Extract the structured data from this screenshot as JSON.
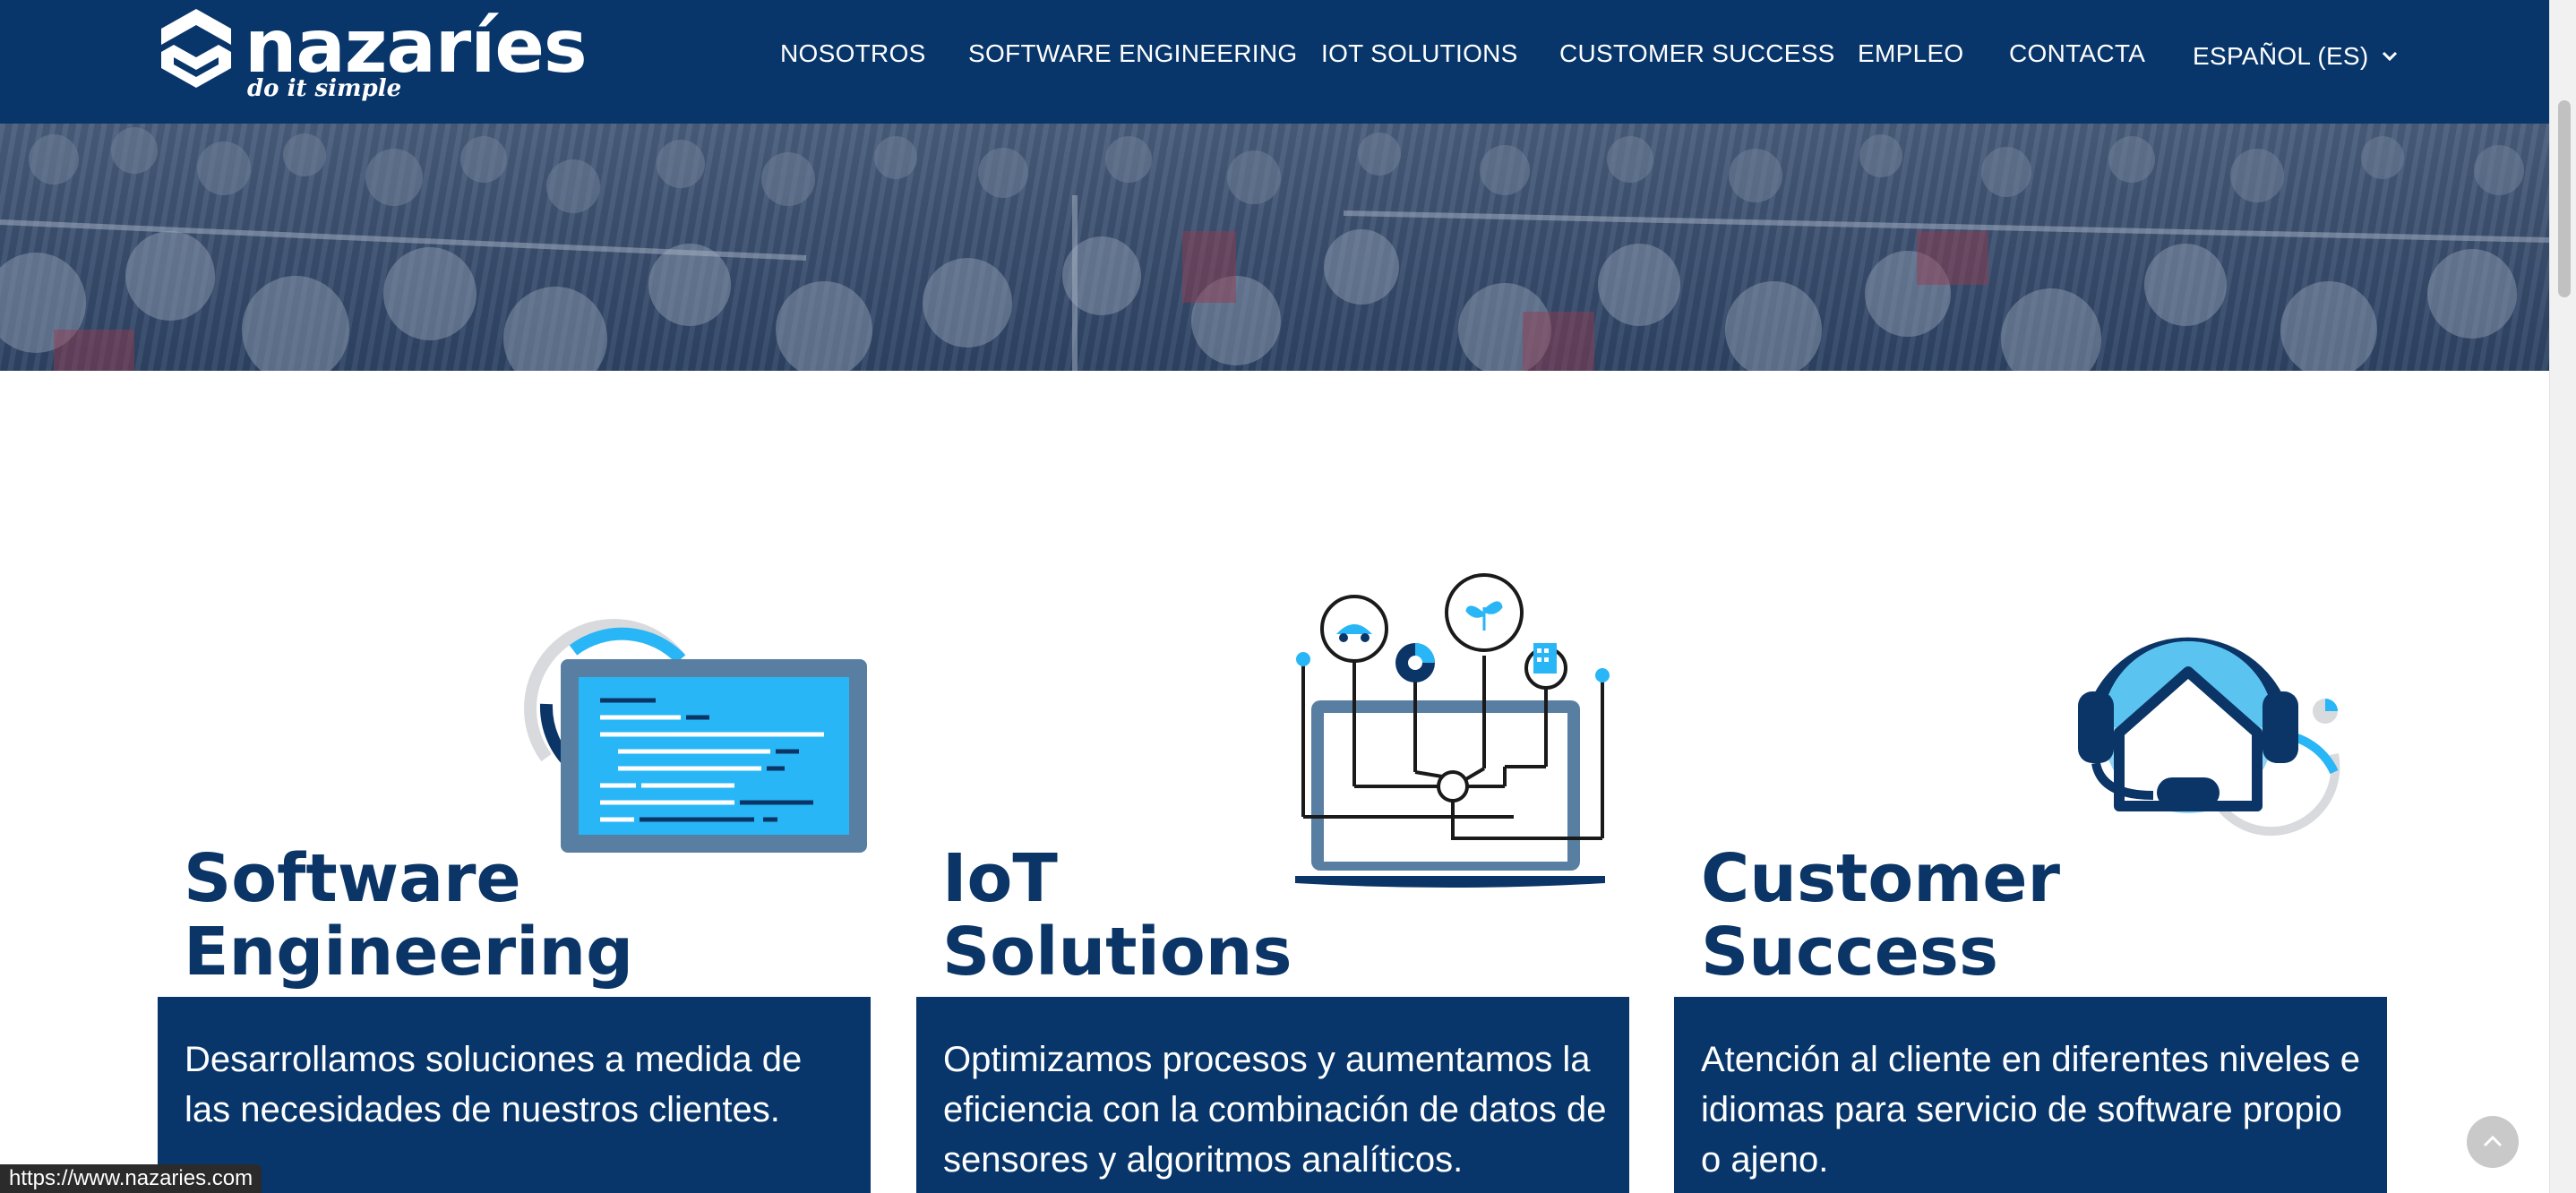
{
  "brand": {
    "name": "nazaríes",
    "tagline": "do it simple",
    "logo_icon": "cube-logo-icon"
  },
  "nav": {
    "items": [
      {
        "label": "NOSOTROS"
      },
      {
        "label": "SOFTWARE ENGINEERING"
      },
      {
        "label": "IOT SOLUTIONS"
      },
      {
        "label": "CUSTOMER SUCCESS"
      },
      {
        "label": "EMPLEO"
      },
      {
        "label": "CONTACTA"
      }
    ],
    "language": {
      "label": "ESPAÑOL (ES)",
      "icon": "chevron-down-icon"
    }
  },
  "cards": [
    {
      "title_line1": "Software",
      "title_line2": "Engineering",
      "description": "Desarrollamos soluciones a medida de las necesidades de nuestros clientes.",
      "icon": "code-monitor-icon"
    },
    {
      "title_line1": "IoT",
      "title_line2": "Solutions",
      "description": "Optimizamos procesos y aumentamos la eficiencia con la combinación de datos de sensores y algoritmos analíticos.",
      "icon": "iot-laptop-icon"
    },
    {
      "title_line1": "Customer",
      "title_line2": "Success",
      "description": "Atención al cliente en diferentes niveles e idiomas para servicio de software propio o ajeno.",
      "icon": "headset-home-icon"
    }
  ],
  "status_bar": {
    "url": "https://www.nazaries.com"
  },
  "colors": {
    "primary": "#08366b",
    "accent": "#29b6f6",
    "illustration_gray": "#d8dadd"
  }
}
